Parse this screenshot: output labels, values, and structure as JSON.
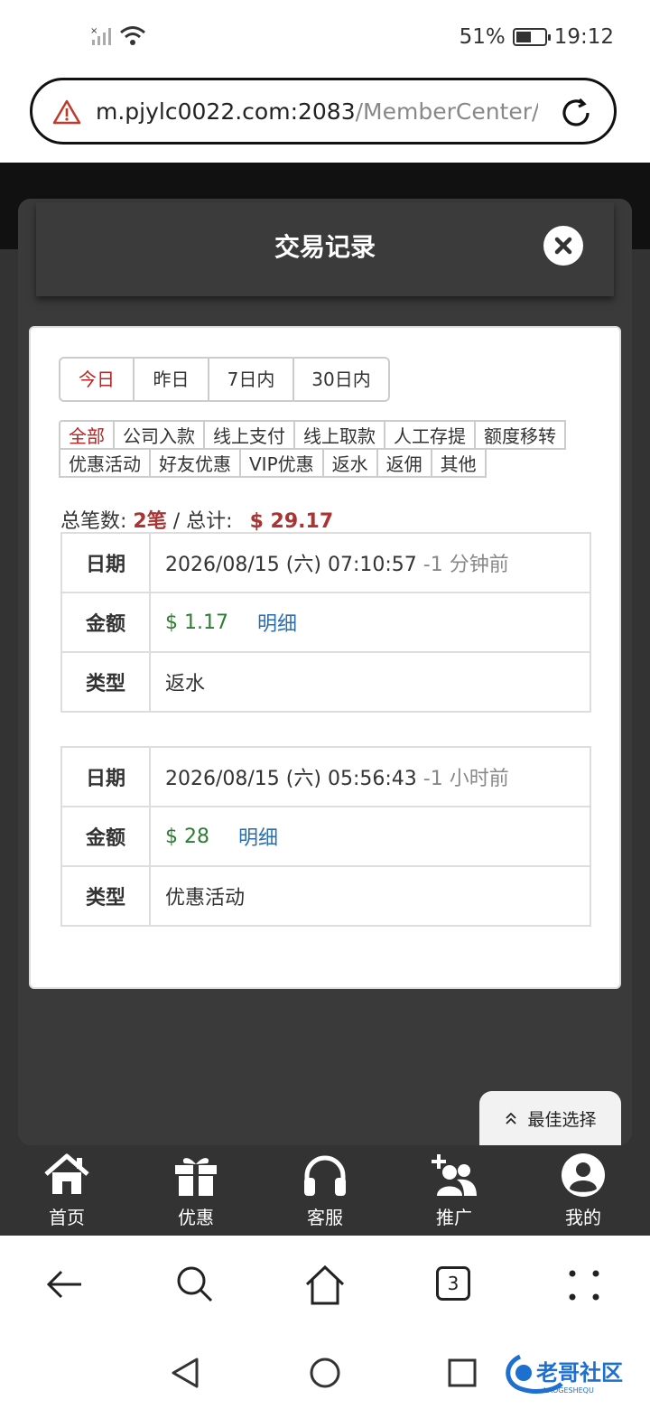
{
  "status": {
    "battery": "51%",
    "time": "19:12"
  },
  "url": {
    "host": "m.pjylc0022.com:2083",
    "path": "/MemberCenter/T"
  },
  "modal": {
    "title": "交易记录"
  },
  "periods": [
    "今日",
    "昨日",
    "7日内",
    "30日内"
  ],
  "filters_row1": [
    "全部",
    "公司入款",
    "线上支付",
    "线上取款",
    "人工存提",
    "额度移转"
  ],
  "filters_row2": [
    "优惠活动",
    "好友优惠",
    "VIP优惠",
    "返水",
    "返佣",
    "其他"
  ],
  "summary": {
    "count_label": "总笔数:",
    "count_value": "2笔",
    "sep": "/",
    "total_label": "总计:",
    "total_value": "$ 29.17"
  },
  "labels": {
    "date": "日期",
    "amount": "金额",
    "type": "类型",
    "detail": "明细"
  },
  "records": [
    {
      "date": "2026/08/15 (六) 07:10:57",
      "relative": "-1 分钟前",
      "amount": "$ 1.17",
      "type": "返水"
    },
    {
      "date": "2026/08/15 (六) 05:56:43",
      "relative": "-1 小时前",
      "amount": "$ 28",
      "type": "优惠活动"
    }
  ],
  "float_button": "最佳选择",
  "nav": [
    "首页",
    "优惠",
    "客服",
    "推广",
    "我的"
  ],
  "browser": {
    "tabs_count": "3"
  },
  "watermark": "老哥社区 LAOGESHEQU"
}
